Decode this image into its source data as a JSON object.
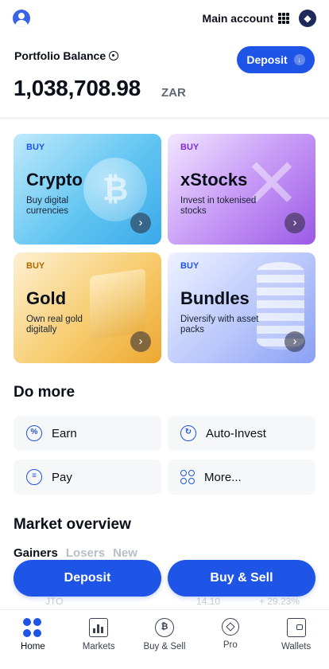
{
  "header": {
    "account_label": "Main account"
  },
  "balance": {
    "label": "Portfolio Balance",
    "amount": "1,038,708.98",
    "currency": "ZAR",
    "deposit_label": "Deposit"
  },
  "cards": [
    {
      "tag": "BUY",
      "title": "Crypto",
      "desc": "Buy digital currencies",
      "icon": "bitcoin-coin"
    },
    {
      "tag": "BUY",
      "title": "xStocks",
      "desc": "Invest in tokenised stocks",
      "icon": "x-shape"
    },
    {
      "tag": "BUY",
      "title": "Gold",
      "desc": "Own real gold digitally",
      "icon": "gold-bar"
    },
    {
      "tag": "BUY",
      "title": "Bundles",
      "desc": "Diversify with asset packs",
      "icon": "coin-stack"
    }
  ],
  "do_more": {
    "title": "Do more",
    "actions": [
      {
        "label": "Earn",
        "icon": "percent-icon"
      },
      {
        "label": "Auto-Invest",
        "icon": "recurring-icon"
      },
      {
        "label": "Pay",
        "icon": "pay-icon"
      },
      {
        "label": "More...",
        "icon": "more-grid-icon"
      }
    ]
  },
  "market": {
    "title": "Market overview",
    "tabs": [
      "Gainers",
      "Losers",
      "New"
    ],
    "partial_row": {
      "name": "JTO",
      "price": "14.10",
      "change": "+ 29.23%"
    }
  },
  "cta": {
    "deposit": "Deposit",
    "buy_sell": "Buy & Sell"
  },
  "nav": [
    {
      "label": "Home",
      "active": true
    },
    {
      "label": "Markets",
      "active": false
    },
    {
      "label": "Buy & Sell",
      "active": false
    },
    {
      "label": "Pro",
      "active": false
    },
    {
      "label": "Wallets",
      "active": false
    }
  ],
  "colors": {
    "accent": "#1f55e6",
    "text": "#0b0f1a",
    "muted": "#b9bdc6"
  }
}
